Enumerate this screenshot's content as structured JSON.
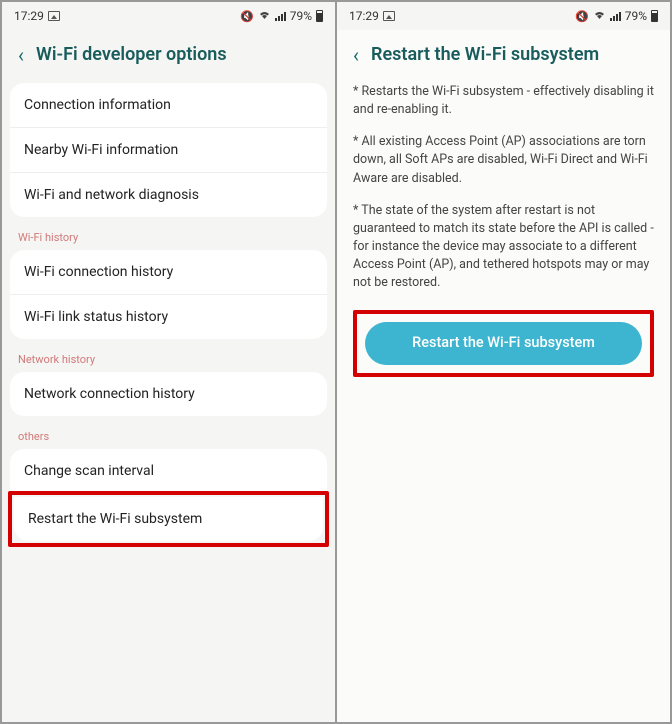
{
  "status": {
    "time": "17:29",
    "battery": "79%"
  },
  "left": {
    "title": "Wi-Fi developer options",
    "group1": {
      "item1": "Connection information",
      "item2": "Nearby Wi-Fi information",
      "item3": "Wi-Fi and network diagnosis"
    },
    "section_wifi_history": "Wi-Fi history",
    "group2": {
      "item1": "Wi-Fi connection history",
      "item2": "Wi-Fi link status history"
    },
    "section_network_history": "Network history",
    "group3": {
      "item1": "Network connection history"
    },
    "section_others": "others",
    "group4": {
      "item1": "Change scan interval",
      "item2": "Restart the Wi-Fi subsystem"
    }
  },
  "right": {
    "title": "Restart the Wi-Fi subsystem",
    "p1": "* Restarts the Wi-Fi subsystem - effectively disabling it and re-enabling it.",
    "p2": "* All existing Access Point (AP) associations are torn down, all Soft APs are disabled, Wi-Fi Direct and Wi-Fi Aware are disabled.",
    "p3": "* The state of the system after restart is not guaranteed to match its state before the API is called - for instance the device may associate to a different Access Point (AP), and tethered hotspots may or may not be restored.",
    "button": "Restart the Wi-Fi subsystem"
  }
}
